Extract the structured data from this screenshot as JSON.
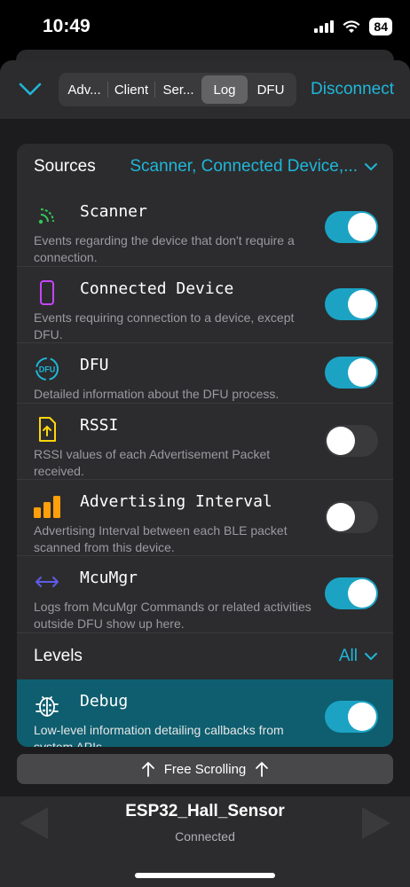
{
  "status_bar": {
    "time": "10:49",
    "battery": "84"
  },
  "navbar": {
    "segments": [
      {
        "label": "Adv...",
        "selected": false
      },
      {
        "label": "Client",
        "selected": false
      },
      {
        "label": "Ser...",
        "selected": false
      },
      {
        "label": "Log",
        "selected": true
      },
      {
        "label": "DFU",
        "selected": false
      }
    ],
    "disconnect_label": "Disconnect"
  },
  "sources": {
    "label": "Sources",
    "value": "Scanner, Connected Device,...",
    "items": [
      {
        "title": "Scanner",
        "desc": "Events regarding the device that don't require a connection.",
        "on": true,
        "icon": "scanner-icon"
      },
      {
        "title": "Connected Device",
        "desc": "Events requiring connection to a device, except DFU.",
        "on": true,
        "icon": "phone-icon"
      },
      {
        "title": "DFU",
        "desc": "Detailed information about the DFU process.",
        "on": true,
        "icon": "dfu-icon"
      },
      {
        "title": "RSSI",
        "desc": "RSSI values of each Advertisement Packet received.",
        "on": false,
        "icon": "upload-doc-icon"
      },
      {
        "title": "Advertising Interval",
        "desc": "Advertising Interval between each BLE packet scanned from this device.",
        "on": false,
        "icon": "bars-icon"
      },
      {
        "title": "McuMgr",
        "desc": "Logs from McuMgr Commands or related activities outside DFU show up here.",
        "on": true,
        "icon": "arrows-icon"
      }
    ]
  },
  "levels": {
    "label": "Levels",
    "value": "All",
    "items": [
      {
        "title": "Debug",
        "desc": "Low-level information detailing callbacks from system APIs.",
        "on": true,
        "icon": "bug-icon"
      }
    ]
  },
  "free_scrolling_label": "Free Scrolling",
  "footer": {
    "device_name": "ESP32_Hall_Sensor",
    "state": "Connected"
  },
  "colors": {
    "accent": "#1fb7d9",
    "toggle_on": "#1ca3c4",
    "highlight": "#0e5e6f"
  }
}
